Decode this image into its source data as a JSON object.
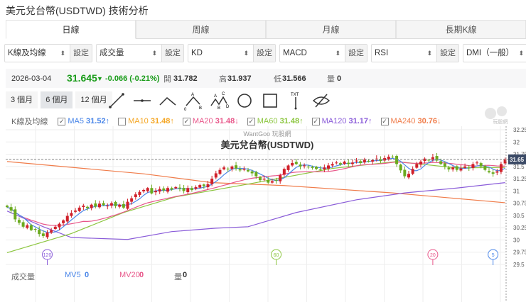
{
  "title": "美元兌台幣(USDTWD) 技術分析",
  "tabs": [
    "日線",
    "周線",
    "月線",
    "長期K線"
  ],
  "selects": [
    {
      "value": "K線及均線",
      "btn": "設定"
    },
    {
      "value": "成交量",
      "btn": "設定"
    },
    {
      "value": "KD",
      "btn": "設定"
    },
    {
      "value": "MACD",
      "btn": "設定"
    },
    {
      "value": "RSI",
      "btn": "設定"
    },
    {
      "value": "DMI（一般）",
      "btn": "設定"
    }
  ],
  "info": {
    "date": "2026-03-04",
    "price": "31.645",
    "change": "-0.066 (-0.21%)",
    "open_label": "開",
    "open": "31.782",
    "high_label": "高",
    "high": "31.937",
    "low_label": "低",
    "low": "31.566",
    "vol_label": "量",
    "vol": "0"
  },
  "ranges": [
    "3 個月",
    "6 個月",
    "12 個月"
  ],
  "tools": [
    "line-tool",
    "horizontal-line-tool",
    "angle-tool",
    "abc-wave-tool",
    "abcd-wave-tool",
    "circle-tool",
    "rectangle-tool",
    "text-tool",
    "hide-drawings-tool"
  ],
  "legend": {
    "label": "K線及均線",
    "items": [
      {
        "name": "MA5",
        "value": "31.52↑",
        "checked": true,
        "color": "#4a86e8"
      },
      {
        "name": "MA10",
        "value": "31.48↑",
        "checked": false,
        "color": "#f5a623"
      },
      {
        "name": "MA20",
        "value": "31.48↓",
        "checked": true,
        "color": "#e8578a"
      },
      {
        "name": "MA60",
        "value": "31.48↑",
        "checked": true,
        "color": "#8cc63f"
      },
      {
        "name": "MA120",
        "value": "31.17↑",
        "checked": true,
        "color": "#8a5cd9"
      },
      {
        "name": "MA240",
        "value": "30.76↓",
        "checked": true,
        "color": "#f07c4a"
      }
    ]
  },
  "watermark": {
    "site": "WantGoo 玩股網",
    "name": "美元兌台幣(USDTWD)",
    "logo_text": "玩股網"
  },
  "volume": {
    "label": "成交量",
    "mv5_label": "MV5",
    "mv5": "0",
    "mv20_label": "MV20",
    "mv20": "0",
    "vol_label": "量",
    "vol": "0"
  },
  "chart_data": {
    "type": "candlestick",
    "ylim": [
      29.5,
      32.25
    ],
    "yticks": [
      "32.25",
      "32",
      "31.75",
      "31.5",
      "31.25",
      "31",
      "30.75",
      "30.5",
      "30.25",
      "30",
      "29.75",
      "29.5"
    ],
    "last_price_tag": "31.65",
    "up_color": "#d0202a",
    "down_color": "#6aaa1e",
    "closes": [
      30.67,
      30.6,
      30.42,
      30.35,
      30.27,
      30.3,
      30.2,
      30.22,
      30.12,
      30.08,
      30.15,
      30.2,
      30.27,
      30.33,
      30.4,
      30.49,
      30.55,
      30.6,
      30.66,
      30.7,
      30.65,
      30.72,
      30.68,
      30.74,
      30.71,
      30.7,
      30.75,
      30.69,
      30.72,
      30.66,
      30.78,
      30.85,
      30.93,
      30.98,
      31.02,
      31.06,
      30.95,
      31.0,
      31.04,
      31.01,
      31.06,
      31.03,
      31.08,
      31.05,
      31.0,
      31.06,
      31.02,
      31.08,
      31.12,
      31.1,
      31.14,
      31.25,
      31.36,
      31.43,
      31.48,
      31.45,
      31.5,
      31.46,
      31.42,
      31.45,
      31.4,
      31.36,
      31.3,
      31.22,
      31.25,
      31.17,
      31.2,
      31.21,
      31.32,
      31.45,
      31.52,
      31.57,
      31.55,
      31.5,
      31.52,
      31.49,
      31.47,
      31.45,
      31.43,
      31.48,
      31.52,
      31.55,
      31.58,
      31.54,
      31.6,
      31.55,
      31.58,
      31.62,
      31.57,
      31.64,
      31.6,
      31.63,
      31.66,
      31.61,
      31.67,
      31.7,
      31.69,
      31.55,
      31.42,
      31.3,
      31.35,
      31.45,
      31.55,
      31.6,
      31.66,
      31.63,
      31.69,
      31.62,
      31.55,
      31.5,
      31.44,
      31.48,
      31.43,
      31.46,
      31.5,
      31.47,
      31.55,
      31.58,
      31.5,
      31.43,
      31.38,
      31.35,
      31.4,
      31.55,
      31.645
    ],
    "ma_long": {
      "MA60": [
        [
          0,
          29.74
        ],
        [
          16,
          30.13
        ],
        [
          29,
          30.56
        ],
        [
          42,
          30.88
        ],
        [
          60,
          31.14
        ],
        [
          81,
          31.46
        ],
        [
          97,
          31.6
        ],
        [
          112,
          31.47
        ],
        [
          124,
          31.48
        ]
      ],
      "MA120": [
        [
          0,
          30.59
        ],
        [
          9,
          30.27
        ],
        [
          16,
          30.05
        ],
        [
          30,
          30.01
        ],
        [
          41,
          30.17
        ],
        [
          52,
          30.24
        ],
        [
          60,
          30.27
        ],
        [
          72,
          30.56
        ],
        [
          87,
          30.82
        ],
        [
          99,
          30.96
        ],
        [
          112,
          31.06
        ],
        [
          124,
          31.17
        ]
      ],
      "MA240": [
        [
          0,
          31.6
        ],
        [
          34,
          31.35
        ],
        [
          51,
          31.17
        ],
        [
          69,
          31.11
        ],
        [
          96,
          30.96
        ],
        [
          124,
          30.76
        ]
      ]
    },
    "period_markers": [
      {
        "label": "120",
        "index": 10,
        "color": "#8a5cd9"
      },
      {
        "label": "60",
        "index": 67,
        "color": "#8cc63f"
      },
      {
        "label": "20",
        "index": 106,
        "color": "#e8578a"
      },
      {
        "label": "5",
        "index": 121,
        "color": "#4a86e8"
      }
    ]
  }
}
